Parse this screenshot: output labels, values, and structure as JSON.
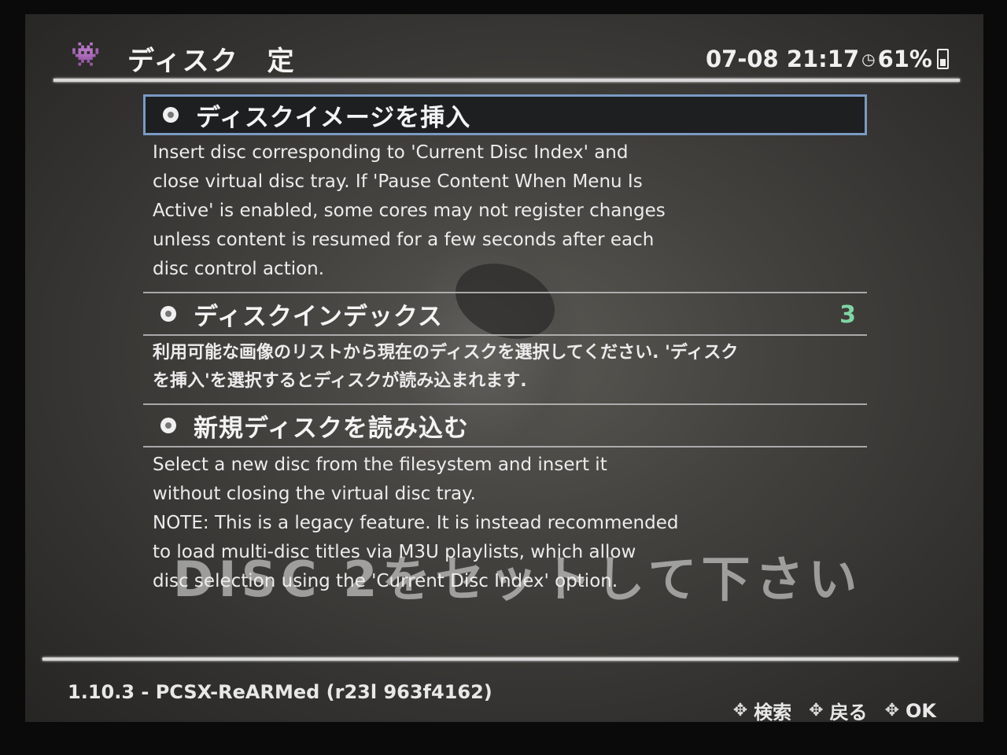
{
  "header": {
    "logo_icon": "invader-icon",
    "title": "ディスク　定",
    "datetime": "07-08 21:17",
    "battery": "61%"
  },
  "menu": {
    "items": [
      {
        "label": "ディスクイメージを挿入",
        "value": "",
        "selected": true,
        "description": "Insert disc corresponding to 'Current Disc Index' and\nclose virtual disc tray. If 'Pause Content When Menu Is\nActive' is enabled, some cores may not register changes\nunless content is resumed for a few seconds after each\ndisc control action."
      },
      {
        "label": "ディスクインデックス",
        "value": "3",
        "selected": false,
        "description": "利用可能な画像のリストから現在のディスクを選択してください. 'ディスク\nを挿入'を選択するとディスクが読み込まれます."
      },
      {
        "label": "新規ディスクを読み込む",
        "value": "",
        "selected": false,
        "description": "Select a new disc from the filesystem and insert it\nwithout closing the virtual disc tray.\nNOTE: This is a legacy feature. It is instead recommended\nto load multi-disc titles via M3U playlists, which allow\ndisc selection using the 'Current Disc Index' option."
      }
    ]
  },
  "overlay_message": "DISC 2をセットして下さい",
  "footer": {
    "version": "1.10.3 - PCSX-ReARMed (r23l 963f4162)",
    "hints": [
      {
        "icon": "dpad-icon",
        "label": "検索"
      },
      {
        "icon": "dpad-icon",
        "label": "戻る"
      },
      {
        "icon": "dpad-icon",
        "label": "OK"
      }
    ]
  }
}
